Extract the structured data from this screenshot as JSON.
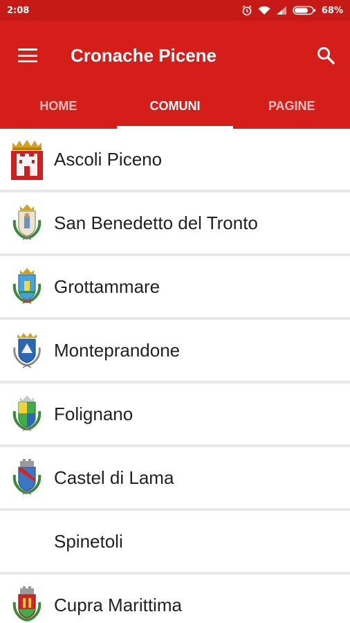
{
  "statusbar": {
    "time": "2:08",
    "battery": "68%"
  },
  "appbar": {
    "title": "Cronache Picene",
    "menu_icon": "hamburger-menu-icon",
    "search_icon": "search-icon"
  },
  "tabs": [
    {
      "label": "HOME",
      "active": false
    },
    {
      "label": "COMUNI",
      "active": true
    },
    {
      "label": "PAGINE",
      "active": false
    }
  ],
  "comuni": [
    {
      "name": "Ascoli Piceno",
      "icon": "ascoli-crest-icon"
    },
    {
      "name": "San Benedetto del Tronto",
      "icon": "san-benedetto-crest-icon"
    },
    {
      "name": "Grottammare",
      "icon": "grottammare-crest-icon"
    },
    {
      "name": "Monteprandone",
      "icon": "monteprandone-crest-icon"
    },
    {
      "name": "Folignano",
      "icon": "folignano-crest-icon"
    },
    {
      "name": "Castel di Lama",
      "icon": "castel-di-lama-crest-icon"
    },
    {
      "name": "Spinetoli",
      "icon": ""
    },
    {
      "name": "Cupra Marittima",
      "icon": "cupra-marittima-crest-icon"
    }
  ],
  "colors": {
    "primary": "#d51d1a",
    "statusbar": "#c61a16",
    "divider": "#e8e8e8"
  }
}
